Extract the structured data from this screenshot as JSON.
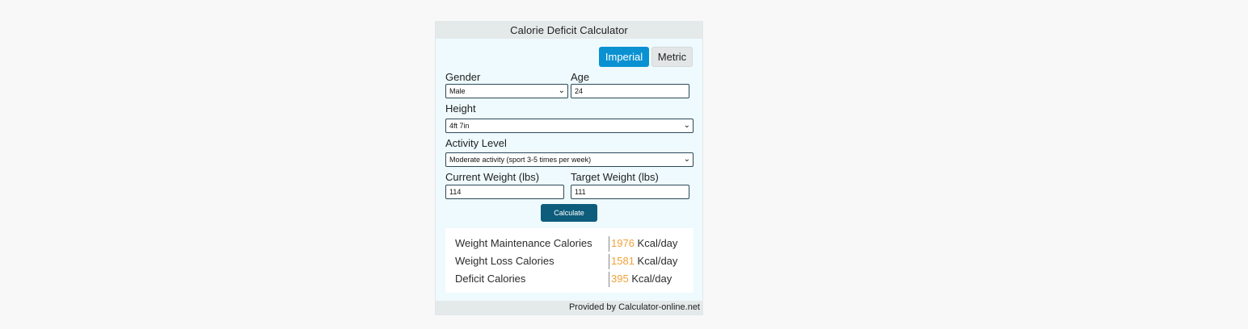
{
  "widget": {
    "title": "Calorie Deficit Calculator",
    "units": {
      "imperial": "Imperial",
      "metric": "Metric",
      "selected": "Imperial"
    },
    "gender": {
      "label": "Gender",
      "value": "Male"
    },
    "age": {
      "label": "Age",
      "value": "24"
    },
    "height": {
      "label": "Height",
      "value": "4ft 7in"
    },
    "activity": {
      "label": "Activity Level",
      "value": "Moderate activity (sport 3-5 times per week)"
    },
    "current_weight": {
      "label": "Current Weight (lbs)",
      "value": "114"
    },
    "target_weight": {
      "label": "Target Weight (lbs)",
      "value": "111"
    },
    "calculate_label": "Calculate",
    "results": [
      {
        "name": "Weight Maintenance Calories",
        "value": "1976",
        "unit": "Kcal/day"
      },
      {
        "name": "Weight Loss Calories",
        "value": "1581",
        "unit": "Kcal/day"
      },
      {
        "name": "Deficit Calories",
        "value": "395",
        "unit": "Kcal/day"
      }
    ],
    "footer": "Provided by Calculator-online.net"
  },
  "icons": {
    "dropdown": "chevron-down-icon"
  },
  "colors": {
    "accent": "#0a91d2",
    "button": "#0d5c7c",
    "result_value": "#f0a23a"
  }
}
